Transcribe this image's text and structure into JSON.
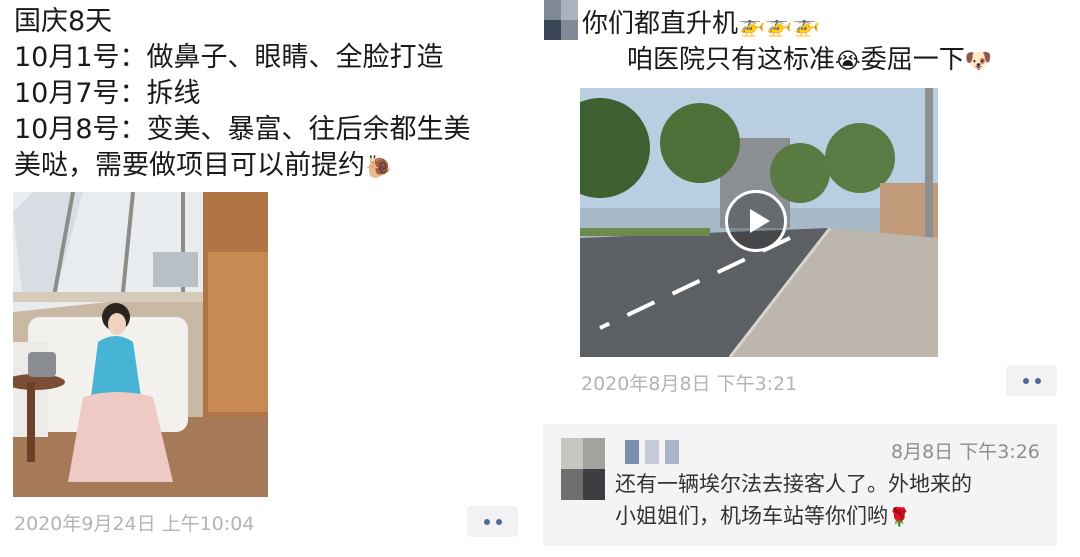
{
  "left_post": {
    "lines": [
      "国庆8天",
      "10月1号：做鼻子、眼睛、全脸打造",
      "10月7号：拆线",
      "10月8号：变美、暴富、往后余都生美",
      "美哒，需要做项目可以前提约"
    ],
    "line5_emoji": "snail-emoji",
    "timestamp": "2020年9月24日 上午10:04"
  },
  "right_post": {
    "line1": "你们都直升机",
    "line1_emoji": "helicopter-emoji x3",
    "line2": "咱医院只有这标准",
    "line2_emoji_mid": "crying-face-emoji",
    "line2_b": "委屈一下",
    "line2_emoji_end": "dog-face-emoji",
    "timestamp": "2020年8月8日 下午3:21",
    "comment": {
      "time": "8月8日 下午3:26",
      "line1": "还有一辆埃尔法去接客人了。外地来的",
      "line2": "小姐姐们，机场车站等你们哟",
      "emoji": "rose-emoji"
    }
  },
  "colors": {
    "timestamp_gray": "#b4b4b4",
    "link_blue": "#4f6b96",
    "comment_bg": "#f4f4f4"
  }
}
